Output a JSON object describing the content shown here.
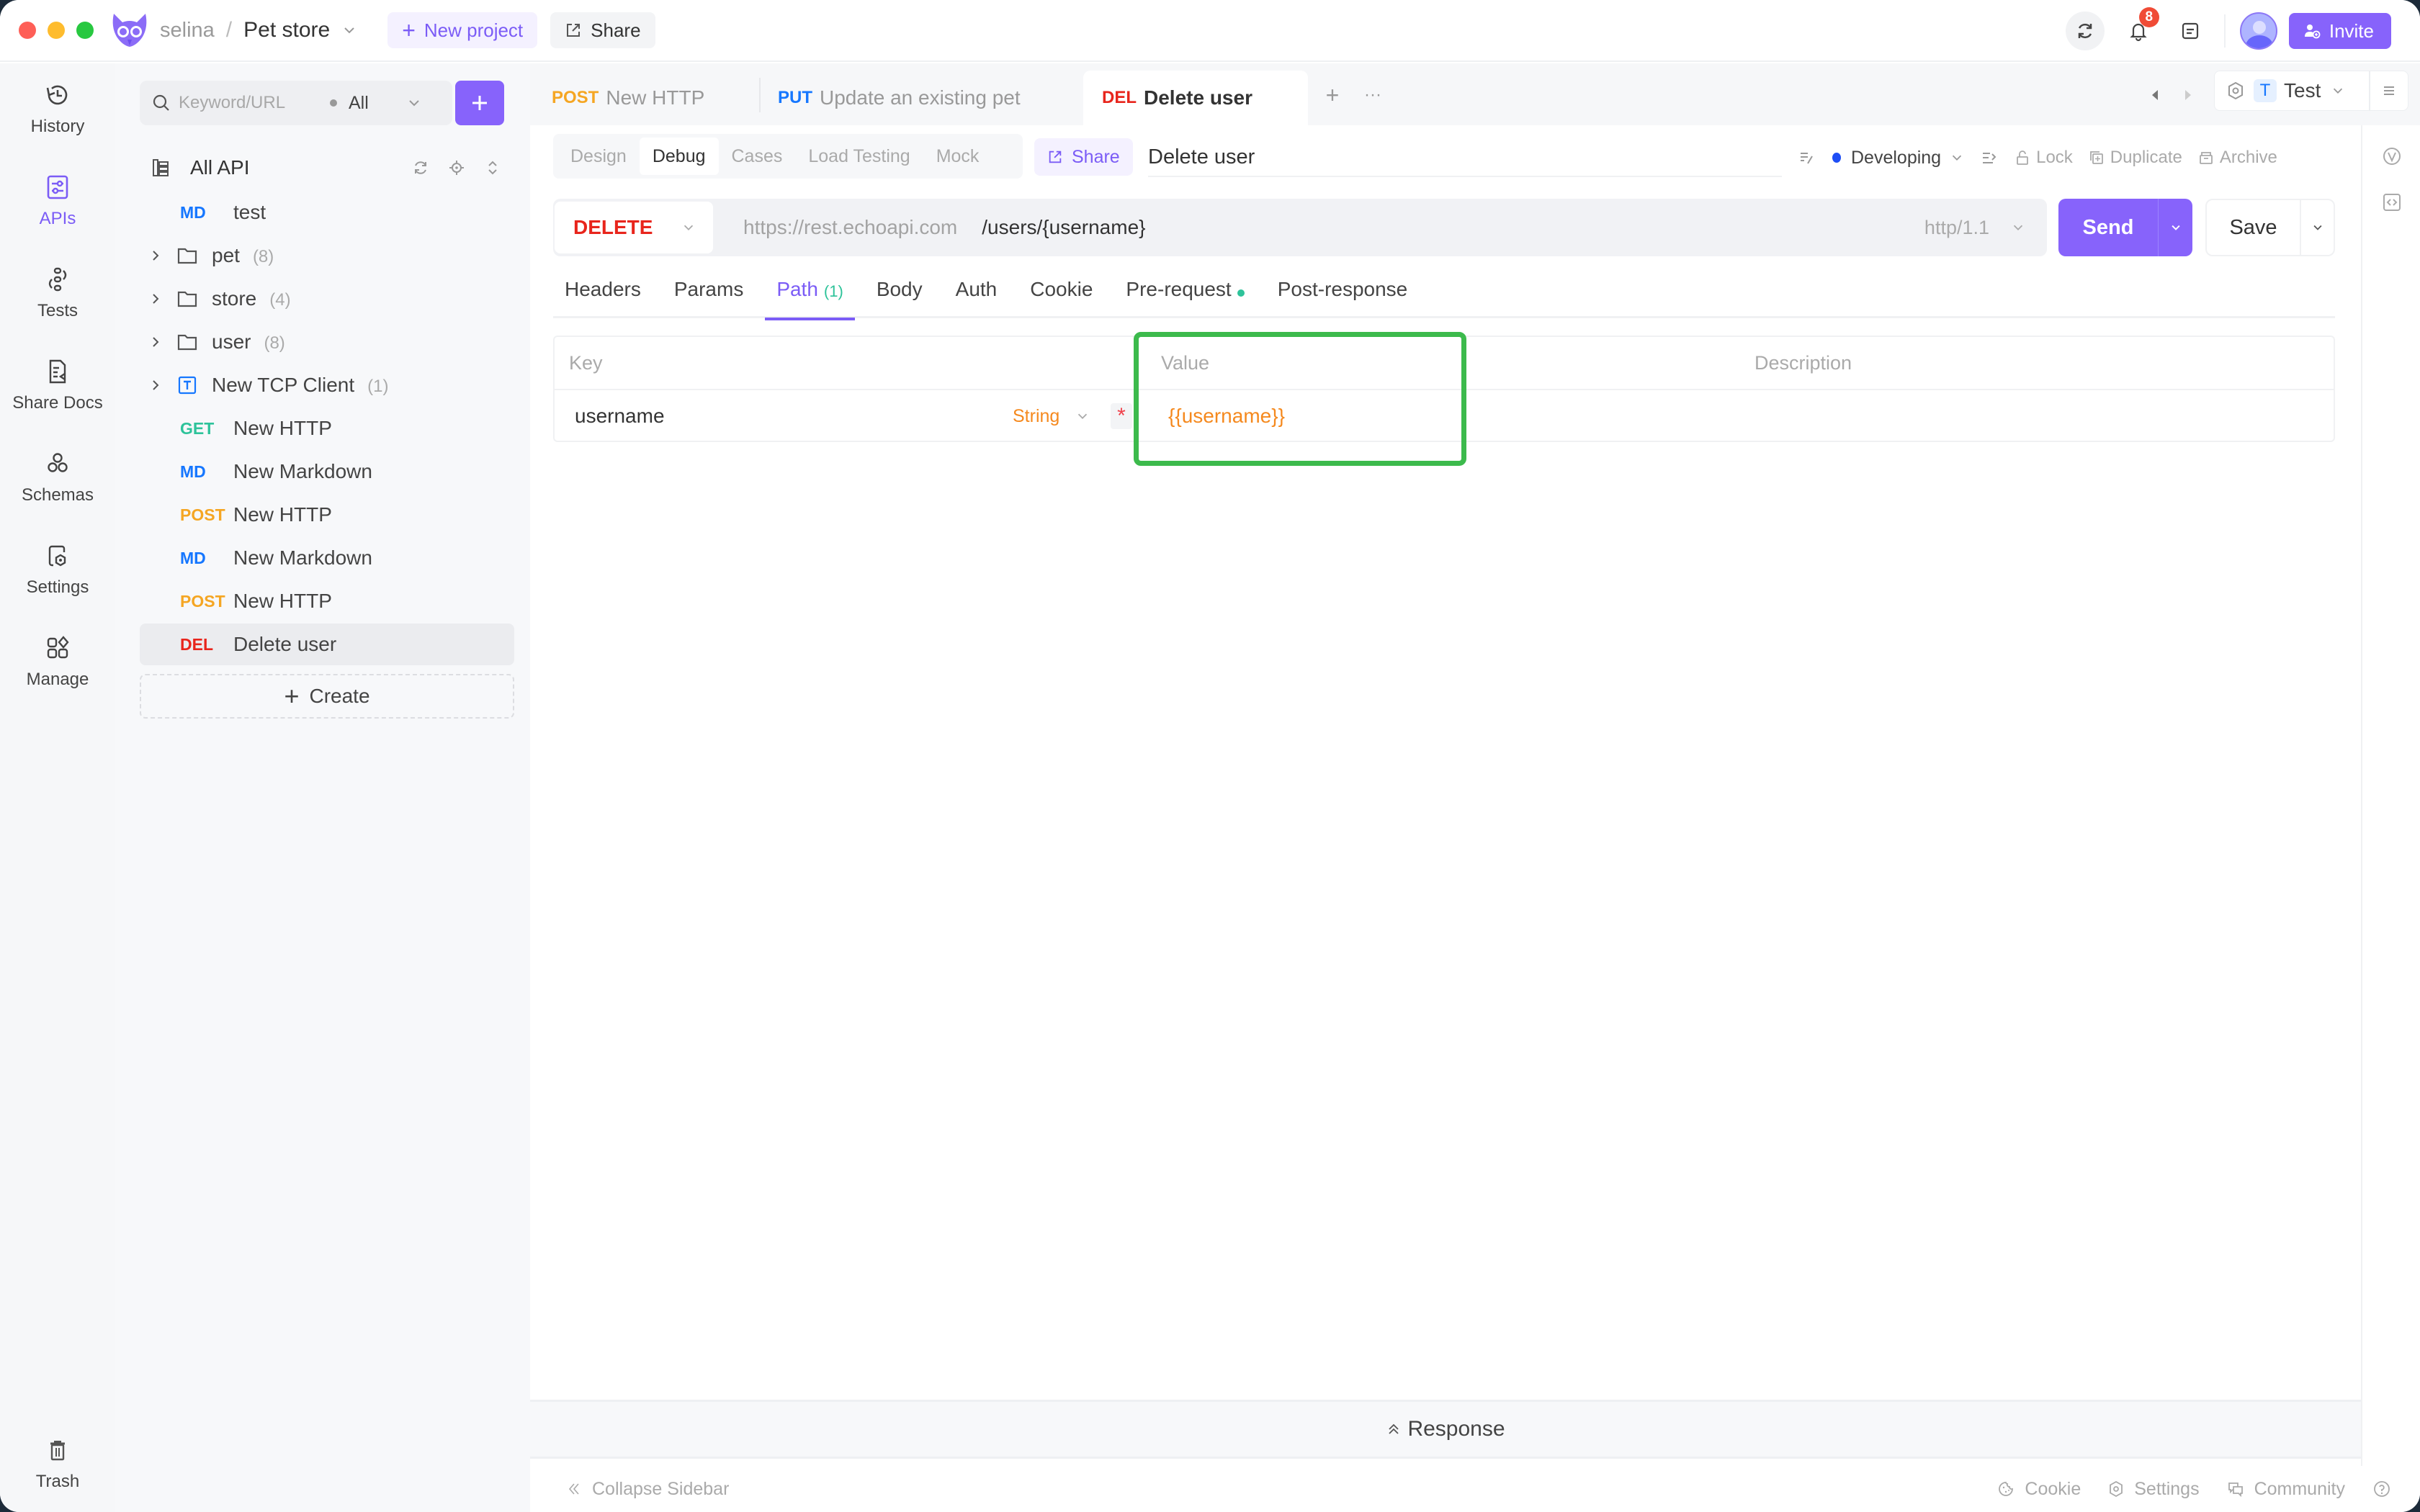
{
  "titlebar": {
    "user": "selina",
    "separator": "/",
    "project": "Pet store",
    "new_project_label": "New project",
    "share_label": "Share",
    "notifications_count": "8",
    "invite_label": "Invite"
  },
  "leftnav": {
    "items": [
      {
        "label": "History",
        "icon": "history-icon"
      },
      {
        "label": "APIs",
        "icon": "apis-icon",
        "active": true
      },
      {
        "label": "Tests",
        "icon": "tests-icon"
      },
      {
        "label": "Share Docs",
        "icon": "share-docs-icon"
      },
      {
        "label": "Schemas",
        "icon": "schemas-icon"
      },
      {
        "label": "Settings",
        "icon": "settings-icon"
      },
      {
        "label": "Manage",
        "icon": "manage-icon"
      }
    ],
    "trash_label": "Trash"
  },
  "sidebar": {
    "search_placeholder": "Keyword/URL",
    "filter_value": "All",
    "root_label": "All API",
    "tree": [
      {
        "type": "item",
        "method": "MD",
        "name": "test"
      },
      {
        "type": "folder",
        "name": "pet",
        "count": "(8)"
      },
      {
        "type": "folder",
        "name": "store",
        "count": "(4)"
      },
      {
        "type": "folder",
        "name": "user",
        "count": "(8)"
      },
      {
        "type": "tcp",
        "name": "New TCP Client",
        "count": "(1)"
      },
      {
        "type": "item",
        "method": "GET",
        "name": "New HTTP"
      },
      {
        "type": "item",
        "method": "MD",
        "name": "New Markdown"
      },
      {
        "type": "item",
        "method": "POST",
        "name": "New HTTP"
      },
      {
        "type": "item",
        "method": "MD",
        "name": "New Markdown"
      },
      {
        "type": "item",
        "method": "POST",
        "name": "New HTTP"
      },
      {
        "type": "item",
        "method": "DEL",
        "name": "Delete user",
        "selected": true
      }
    ],
    "create_label": "Create"
  },
  "tabs": [
    {
      "method": "POST",
      "name": "New HTTP"
    },
    {
      "method": "PUT",
      "name": "Update an existing pet"
    },
    {
      "method": "DEL",
      "name": "Delete user",
      "active": true
    }
  ],
  "environment": {
    "badge": "T",
    "name": "Test"
  },
  "subtabs": [
    "Design",
    "Debug",
    "Cases",
    "Load Testing",
    "Mock"
  ],
  "subtab_active": "Debug",
  "share_label": "Share",
  "api_name": "Delete user",
  "doc_actions": {
    "status": "Developing",
    "lock": "Lock",
    "duplicate": "Duplicate",
    "archive": "Archive"
  },
  "request": {
    "method": "DELETE",
    "base_url": "https://rest.echoapi.com",
    "path": "/users/{username}",
    "protocol": "http/1.1",
    "send_label": "Send",
    "save_label": "Save"
  },
  "request_tabs": [
    {
      "label": "Headers"
    },
    {
      "label": "Params"
    },
    {
      "label": "Path",
      "count": "(1)",
      "active": true
    },
    {
      "label": "Body"
    },
    {
      "label": "Auth"
    },
    {
      "label": "Cookie"
    },
    {
      "label": "Pre-request",
      "indicator": true
    },
    {
      "label": "Post-response"
    }
  ],
  "params": {
    "headers": {
      "key": "Key",
      "value": "Value",
      "description": "Description"
    },
    "rows": [
      {
        "key": "username",
        "type": "String",
        "required": "*",
        "value": "{{username}}",
        "description": ""
      }
    ]
  },
  "response_label": "Response",
  "footer": {
    "collapse_label": "Collapse Sidebar",
    "cookie": "Cookie",
    "settings": "Settings",
    "community": "Community"
  },
  "colors": {
    "accent": "#8763fb",
    "get": "#2ec39a",
    "post": "#f5a623",
    "put": "#1677ff",
    "md": "#1677ff",
    "del": "#e8251c",
    "highlight": "#3cba4c",
    "variable": "#f5891e"
  }
}
